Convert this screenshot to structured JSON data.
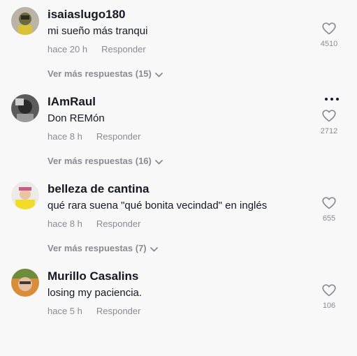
{
  "comments": [
    {
      "username": "isaiaslugo180",
      "text": "mi sueño más tranqui",
      "time": "hace 20 h",
      "reply_label": "Responder",
      "likes": "4510",
      "more_replies": "Ver más respuestas (15)",
      "has_menu": false,
      "avatar_icon": "avatar-icon"
    },
    {
      "username": "IAmRaul",
      "text": "Don REMón",
      "time": "hace 8 h",
      "reply_label": "Responder",
      "likes": "2712",
      "more_replies": "Ver más respuestas (16)",
      "has_menu": true,
      "avatar_icon": "avatar-icon"
    },
    {
      "username": "belleza de cantina",
      "text": "qué rara suena \"qué bonita vecindad\" en inglés",
      "time": "hace 8 h",
      "reply_label": "Responder",
      "likes": "655",
      "more_replies": "Ver más respuestas (7)",
      "has_menu": false,
      "avatar_icon": "avatar-icon"
    },
    {
      "username": "Murillo Casalins",
      "text": "losing my paciencia.",
      "time": "hace 5 h",
      "reply_label": "Responder",
      "likes": "106",
      "has_menu": false,
      "avatar_icon": "avatar-icon"
    }
  ],
  "icons": {
    "like": "heart-outline-icon",
    "expand": "chevron-down-icon",
    "menu": "more-options-icon"
  },
  "colors": {
    "background": "#f8f8f8",
    "primary_text": "#161823",
    "secondary_text": "#8a8b91"
  }
}
